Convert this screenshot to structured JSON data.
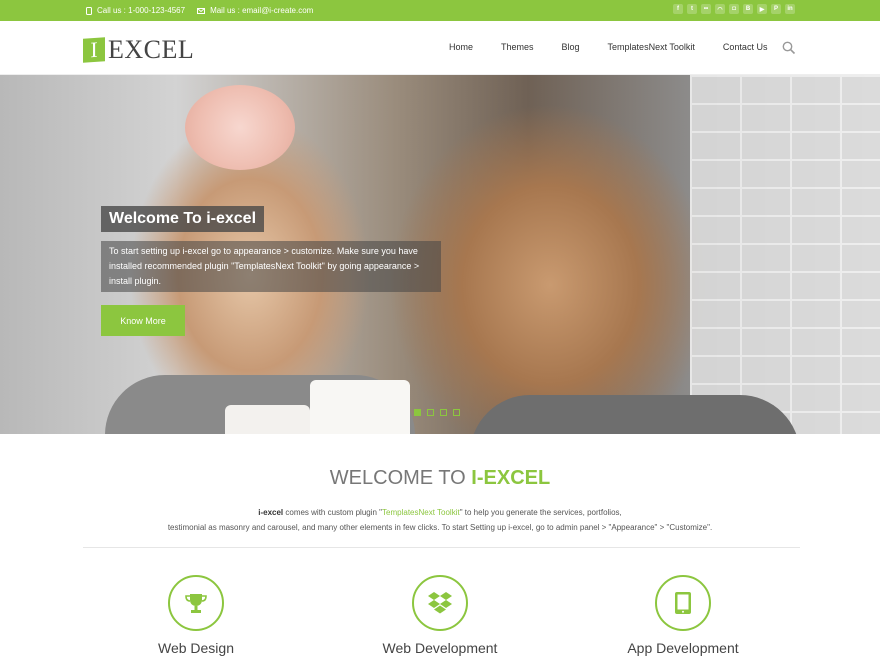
{
  "topbar": {
    "phone": "Call us : 1-000-123-4567",
    "mail": "Mail us : email@i-create.com",
    "social": [
      "f",
      "t",
      "fl",
      "rss",
      "ig",
      "be",
      "yt",
      "p",
      "in"
    ]
  },
  "header": {
    "logo_badge": "I",
    "logo_text": "EXCEL",
    "nav": [
      "Home",
      "Themes",
      "Blog",
      "TemplatesNext Toolkit",
      "Contact Us"
    ]
  },
  "hero": {
    "title": "Welcome To i-excel",
    "text": "To start setting up i-excel go to appearance > customize. Make sure you have installed recommended plugin \"TemplatesNext Toolkit\" by going appearance > install plugin.",
    "button": "Know More",
    "active_slide": 1,
    "slide_count": 4
  },
  "welcome": {
    "title_plain": "WELCOME TO ",
    "title_hl": "I-EXCEL",
    "line1_bold": "i-excel",
    "line1_a": " comes with custom plugin \"",
    "line1_link": "TemplatesNext Toolkit",
    "line1_b": "\" to help you generate the services, portfolios,",
    "line2": "testimonial as masonry and carousel, and many other elements in few clicks. To start Setting up i-excel, go to admin panel > \"Appearance\" > \"Customize\"."
  },
  "services": [
    {
      "label": "Web Design",
      "icon": "trophy-icon"
    },
    {
      "label": "Web Development",
      "icon": "dropbox-icon"
    },
    {
      "label": "App Development",
      "icon": "tablet-icon"
    }
  ],
  "colors": {
    "accent": "#8cc63f",
    "text": "#444444"
  }
}
